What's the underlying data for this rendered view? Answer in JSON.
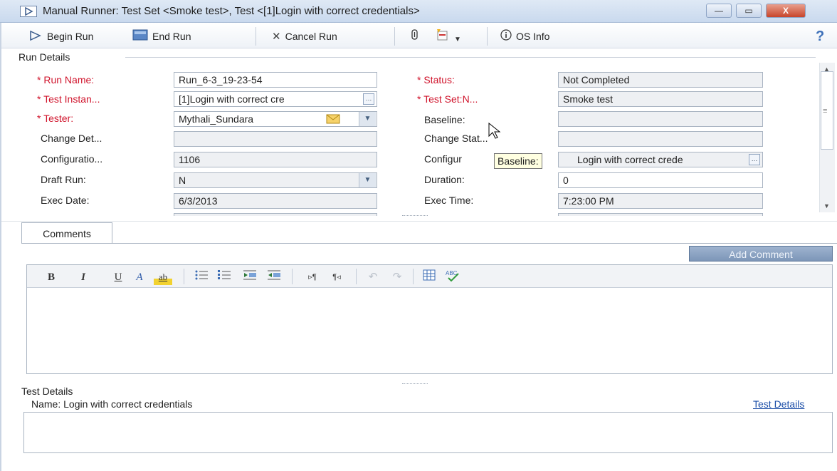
{
  "window": {
    "title": "Manual Runner: Test Set <Smoke test>, Test <[1]Login with correct credentials>",
    "minimize": "—",
    "maximize": "▭",
    "close": "X"
  },
  "toolbar": {
    "begin_run": "Begin Run",
    "end_run": "End Run",
    "cancel_run": "Cancel Run",
    "os_info": "OS Info",
    "help": "?"
  },
  "run_details": {
    "header": "Run Details",
    "fields": {
      "run_name": {
        "label": "Run Name:",
        "value": "Run_6-3_19-23-54"
      },
      "test_instance": {
        "label": "Test Instan...",
        "value": "[1]Login with correct cre"
      },
      "tester": {
        "label": "Tester:",
        "value": "Mythali_Sundara"
      },
      "change_det": {
        "label": "Change Det...",
        "value": ""
      },
      "configuration": {
        "label": "Configuratio...",
        "value": "1106"
      },
      "draft_run": {
        "label": "Draft Run:",
        "value": "N"
      },
      "exec_date": {
        "label": "Exec Date:",
        "value": "6/3/2013"
      },
      "status": {
        "label": "Status:",
        "value": "Not Completed"
      },
      "test_set": {
        "label": "Test Set:N...",
        "value": "Smoke test"
      },
      "baseline": {
        "label": "Baseline:",
        "value": ""
      },
      "change_stat": {
        "label": "Change Stat...",
        "value": ""
      },
      "configur": {
        "label": "Configur",
        "value": "Login with correct crede"
      },
      "duration": {
        "label": "Duration:",
        "value": "0"
      },
      "exec_time": {
        "label": "Exec Time:",
        "value": "7:23:00 PM"
      }
    },
    "tooltip": "Baseline:",
    "required_marker": "*"
  },
  "comments": {
    "tab": "Comments",
    "add_comment": "Add Comment",
    "editor_buttons": {
      "bold": "B",
      "italic": "I",
      "underline": "U",
      "font_color": "A",
      "highlight": "ab"
    }
  },
  "test_details": {
    "header": "Test Details",
    "name_line": "Name: Login with correct credentials",
    "link": "Test Details"
  },
  "colors": {
    "required": "#d0142c",
    "link": "#1d4fa8",
    "add_comment_bg": "#7d96b8"
  }
}
